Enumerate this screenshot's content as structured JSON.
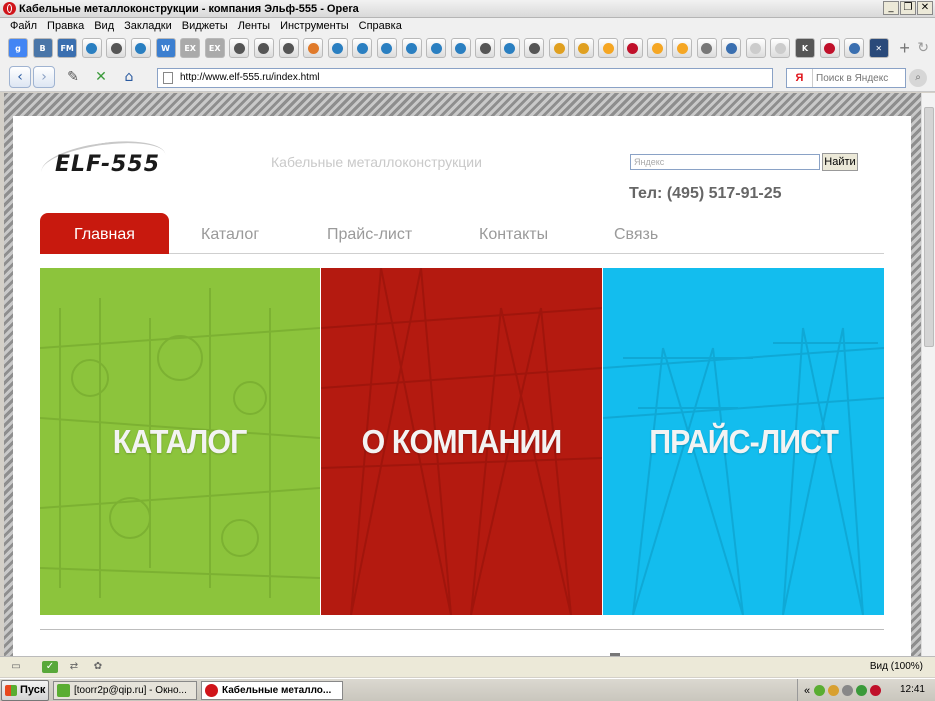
{
  "window": {
    "title": "Кабельные металлоконструкции - компания Эльф-555 - Opera",
    "buttons": [
      "_",
      "❐",
      "✕"
    ]
  },
  "menu": [
    "Файл",
    "Правка",
    "Вид",
    "Закладки",
    "Виджеты",
    "Ленты",
    "Инструменты",
    "Справка"
  ],
  "bookmarks": [
    {
      "icon": "google-icon",
      "color": "#4285f4",
      "text": "g"
    },
    {
      "icon": "vk-icon",
      "color": "#4a76a8",
      "text": "B"
    },
    {
      "icon": "fm-icon",
      "color": "#3a6fb0",
      "text": "FM"
    },
    {
      "icon": "drupal-icon",
      "color": "#2a7fc1",
      "text": ""
    },
    {
      "icon": "drupal-icon",
      "color": "#555555",
      "text": ""
    },
    {
      "icon": "drupal-icon",
      "color": "#2a7fc1",
      "text": ""
    },
    {
      "icon": "word-icon",
      "color": "#3c7fd0",
      "text": "W"
    },
    {
      "icon": "ex-icon",
      "color": "#aaaaaa",
      "text": "EX"
    },
    {
      "icon": "ex-icon",
      "color": "#aaaaaa",
      "text": "EX"
    },
    {
      "icon": "drupal-icon",
      "color": "#555555",
      "text": ""
    },
    {
      "icon": "drupal-icon",
      "color": "#555555",
      "text": ""
    },
    {
      "icon": "drupal-icon",
      "color": "#555555",
      "text": ""
    },
    {
      "icon": "hammer-icon",
      "color": "#e07a2a",
      "text": ""
    },
    {
      "icon": "drupal-icon",
      "color": "#2a7fc1",
      "text": ""
    },
    {
      "icon": "drupal-icon",
      "color": "#2a7fc1",
      "text": ""
    },
    {
      "icon": "drupal-icon",
      "color": "#2a7fc1",
      "text": ""
    },
    {
      "icon": "drupal-icon",
      "color": "#2a7fc1",
      "text": ""
    },
    {
      "icon": "drupal-icon",
      "color": "#2a7fc1",
      "text": ""
    },
    {
      "icon": "drupal-icon",
      "color": "#2a7fc1",
      "text": ""
    },
    {
      "icon": "drupal-icon",
      "color": "#555555",
      "text": ""
    },
    {
      "icon": "drupal-icon",
      "color": "#2a7fc1",
      "text": ""
    },
    {
      "icon": "drupal-icon",
      "color": "#555555",
      "text": ""
    },
    {
      "icon": "tractor-icon",
      "color": "#e0a020",
      "text": ""
    },
    {
      "icon": "tractor-icon",
      "color": "#e0a020",
      "text": ""
    },
    {
      "icon": "clock-icon",
      "color": "#f5a623",
      "text": ""
    },
    {
      "icon": "record-icon",
      "color": "#c0102a",
      "text": ""
    },
    {
      "icon": "clock-icon",
      "color": "#f5a623",
      "text": ""
    },
    {
      "icon": "clock-icon",
      "color": "#f5a623",
      "text": ""
    },
    {
      "icon": "gear-icon",
      "color": "#777777",
      "text": ""
    },
    {
      "icon": "shield-icon",
      "color": "#3a6fb0",
      "text": ""
    },
    {
      "icon": "blank-icon",
      "color": "#cccccc",
      "text": ""
    },
    {
      "icon": "blank-icon",
      "color": "#cccccc",
      "text": ""
    },
    {
      "icon": "k-icon",
      "color": "#555555",
      "text": "K"
    },
    {
      "icon": "record-icon",
      "color": "#c0102a",
      "text": ""
    },
    {
      "icon": "wrench-icon",
      "color": "#3a6fb0",
      "text": ""
    },
    {
      "icon": "close-x-icon",
      "color": "#2a4a7a",
      "text": "✕"
    }
  ],
  "address": {
    "url": "http://www.elf-555.ru/index.html",
    "search_logo": "Я",
    "search_placeholder": "Поиск в Яндекс"
  },
  "site": {
    "logo_text": "ELF-555",
    "tagline": "Кабельные металлоконструкции",
    "search_placeholder": "Яндекс",
    "search_button": "Найти",
    "phone": "Тел: (495) 517-91-25",
    "nav": [
      {
        "label": "Главная",
        "active": true
      },
      {
        "label": "Каталог",
        "active": false
      },
      {
        "label": "Прайс-лист",
        "active": false
      },
      {
        "label": "Контакты",
        "active": false
      },
      {
        "label": "Связь",
        "active": false
      }
    ],
    "panels": [
      {
        "label": "КАТАЛОГ",
        "color": "#8cc43c"
      },
      {
        "label": "О КОМПАНИИ",
        "color": "#b41a10"
      },
      {
        "label": "ПРАЙС-ЛИСТ",
        "color": "#13bdee"
      }
    ]
  },
  "status": {
    "zoom": "Вид (100%)"
  },
  "taskbar": {
    "start": "Пуск",
    "tasks": [
      {
        "label": "[toorr2p@qip.ru] - Окно...",
        "active": false
      },
      {
        "label": "Кабельные металло...",
        "active": true
      }
    ],
    "clock": "12:41"
  }
}
